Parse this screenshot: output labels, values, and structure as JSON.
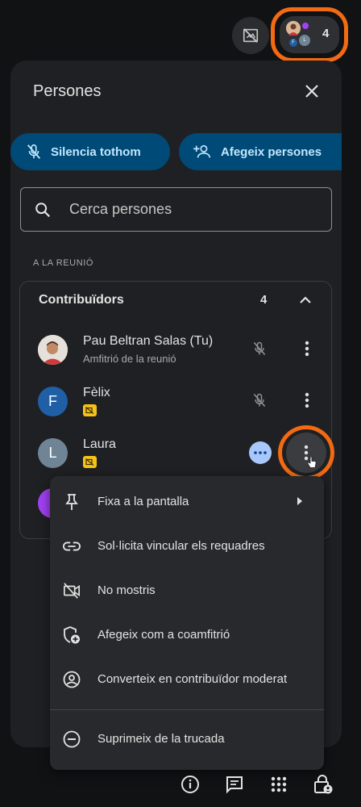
{
  "panel": {
    "title": "Persones",
    "mute_all_label": "Silencia tothom",
    "add_people_label": "Afegeix persones",
    "search_placeholder": "Cerca persones",
    "section_label": "A LA REUNIÓ"
  },
  "header": {
    "people_count": "4",
    "mini_avatars": [
      "F",
      "L"
    ]
  },
  "group": {
    "title": "Contribuïdors",
    "count": "4"
  },
  "participants": [
    {
      "name": "Pau Beltran Salas (Tu)",
      "subtitle": "Amfitrió de la reunió",
      "avatar": "photo"
    },
    {
      "name": "Fèlix",
      "initial": "F",
      "avatar_color": "#1f5fa6"
    },
    {
      "name": "Laura",
      "initial": "L",
      "avatar_color": "#6f8596"
    },
    {
      "avatar_color": "#a142f4"
    }
  ],
  "context_menu": {
    "items": [
      {
        "label": "Fixa a la pantalla",
        "icon": "pin-icon"
      },
      {
        "label": "Sol·licita vincular els requadres",
        "icon": "link-icon"
      },
      {
        "label": "No mostris",
        "icon": "video-off-icon"
      },
      {
        "label": "Afegeix com a coamfitrió",
        "icon": "shield-add-icon"
      },
      {
        "label": "Converteix en contribuïdor moderat",
        "icon": "account-circle-icon"
      },
      {
        "label": "Suprimeix de la trucada",
        "icon": "remove-circle-icon"
      }
    ]
  },
  "colors": {
    "accent_highlight": "#f36a12",
    "button_bg": "#004a77",
    "button_text": "#c2e7ff",
    "badge_yellow": "#f6c21a"
  }
}
